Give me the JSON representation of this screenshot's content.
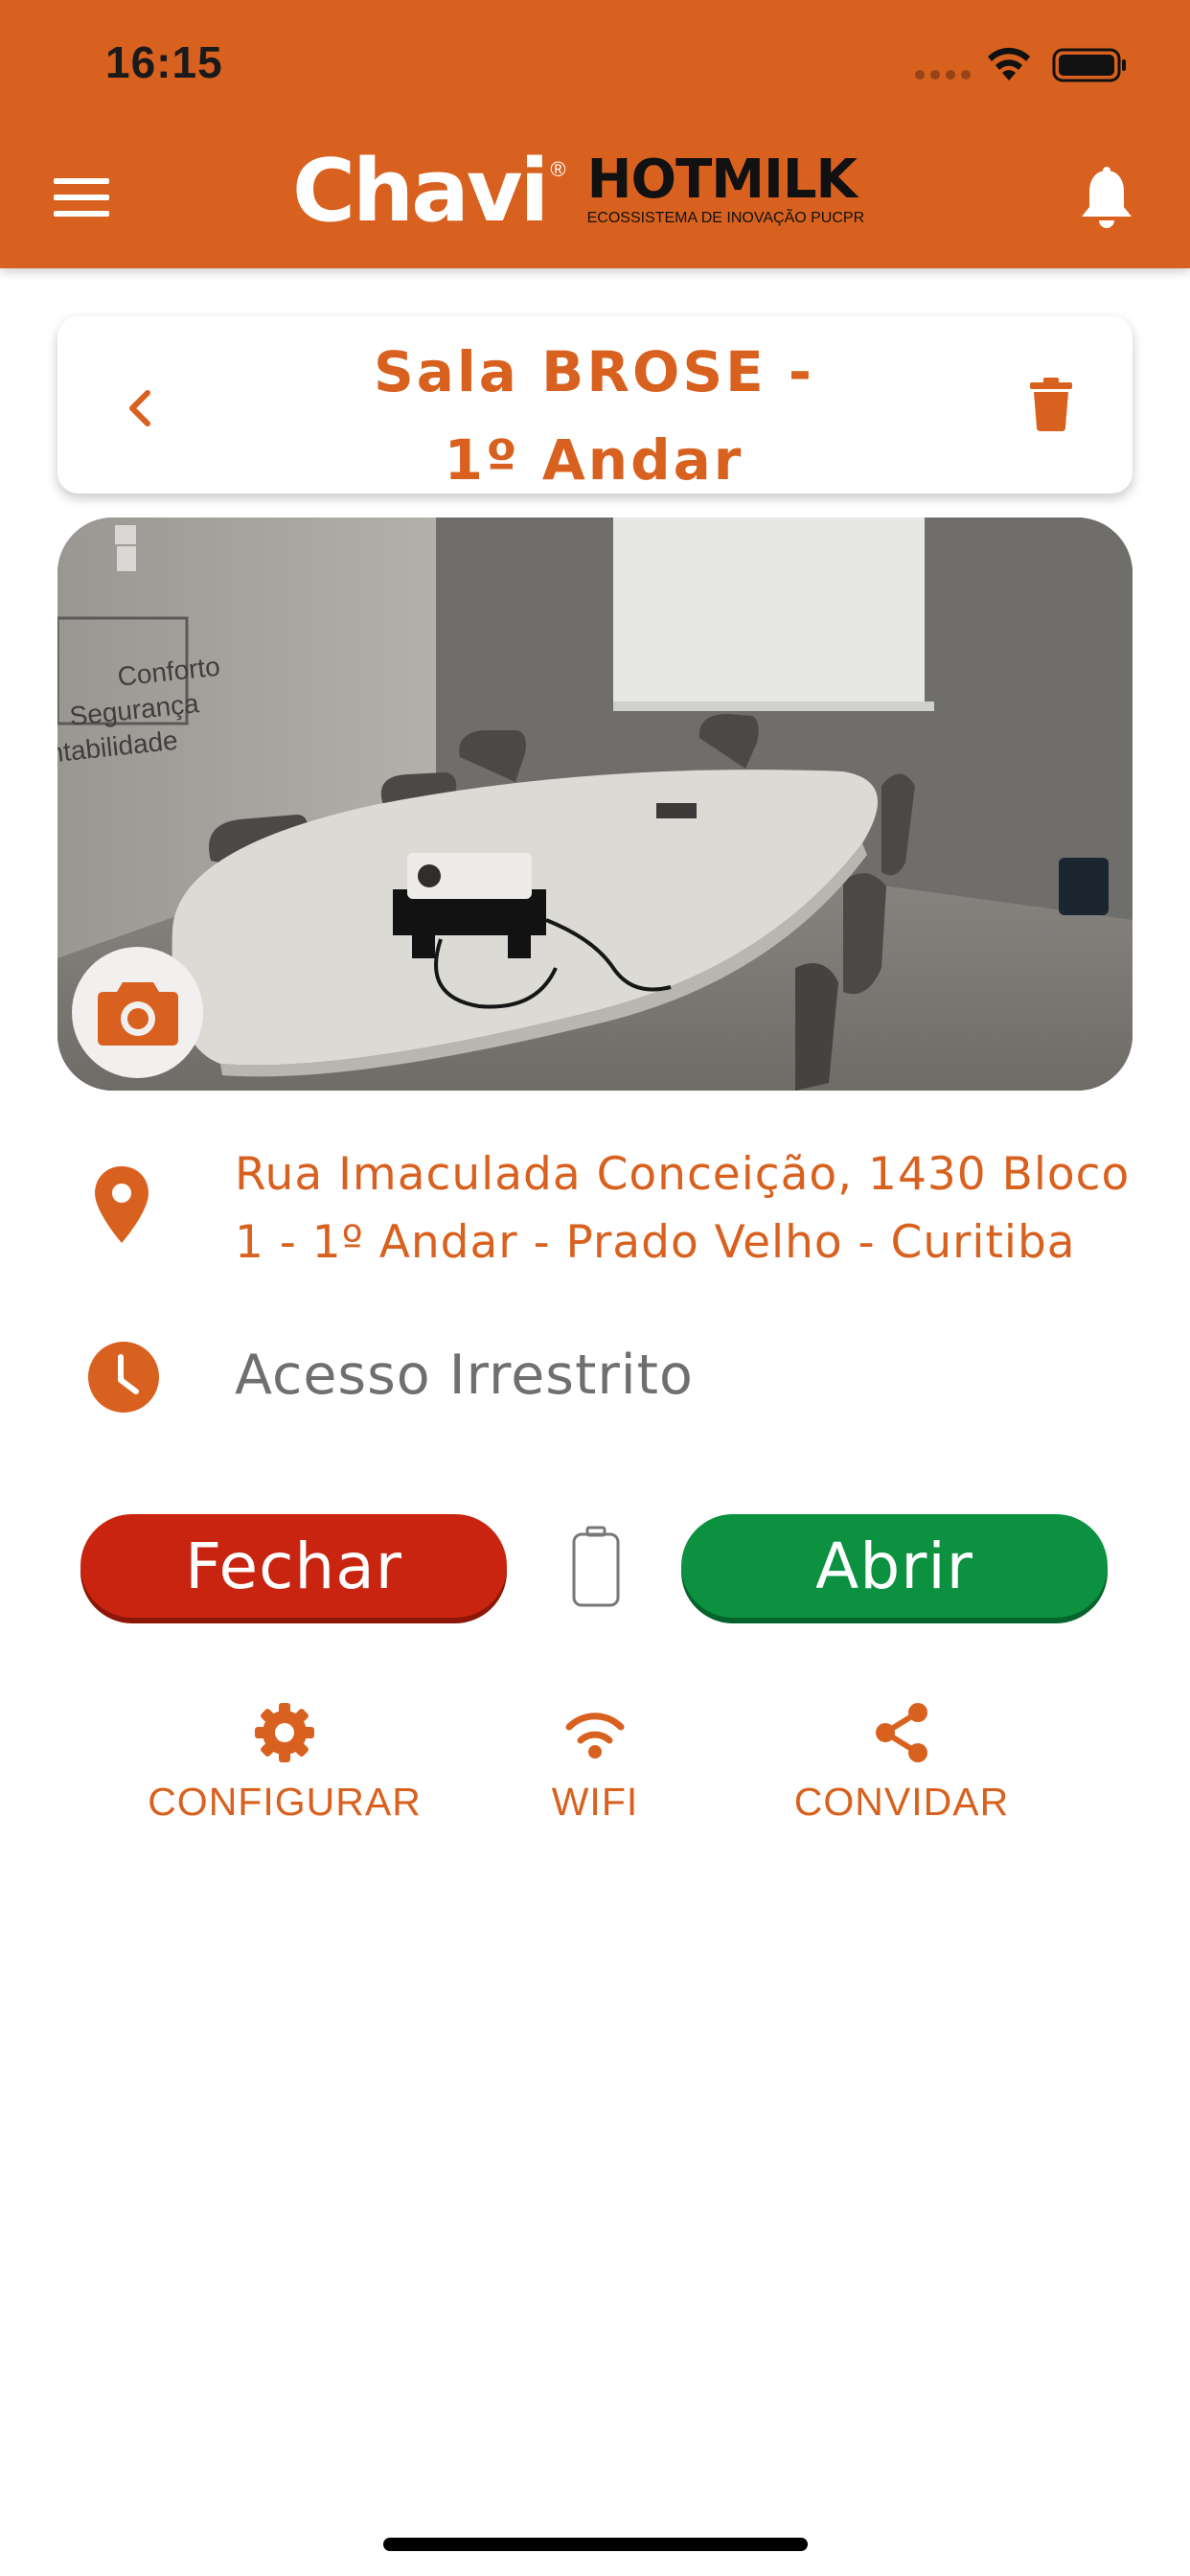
{
  "status_bar": {
    "time": "16:15"
  },
  "header": {
    "logo_chavi": "Chavi",
    "logo_registered": "®",
    "logo_partner": "HOTMILK",
    "logo_partner_sub": "ECOSSISTEMA DE INOVAÇÃO PUCPR",
    "menu_icon": "hamburger-menu-icon",
    "notifications_icon": "bell-icon"
  },
  "room": {
    "title": "Sala BROSE - 1º Andar",
    "photo_wall_text": [
      "Conforto",
      "Segurança",
      "Sustentabilidade"
    ],
    "address": "Rua Imaculada Conceição, 1430 Bloco 1 - 1º Andar - Prado Velho - Curitiba",
    "access": "Acesso Irrestrito"
  },
  "controls": {
    "close_label": "Fechar",
    "open_label": "Abrir"
  },
  "actions": [
    {
      "label": "CONFIGURAR",
      "icon": "gear-icon"
    },
    {
      "label": "WIFI",
      "icon": "wifi-icon"
    },
    {
      "label": "CONVIDAR",
      "icon": "share-icon"
    }
  ],
  "colors": {
    "brand_orange": "#d8611f",
    "close_red": "#c9240f",
    "open_green": "#0b9140",
    "muted_text": "#6f6f6f"
  }
}
